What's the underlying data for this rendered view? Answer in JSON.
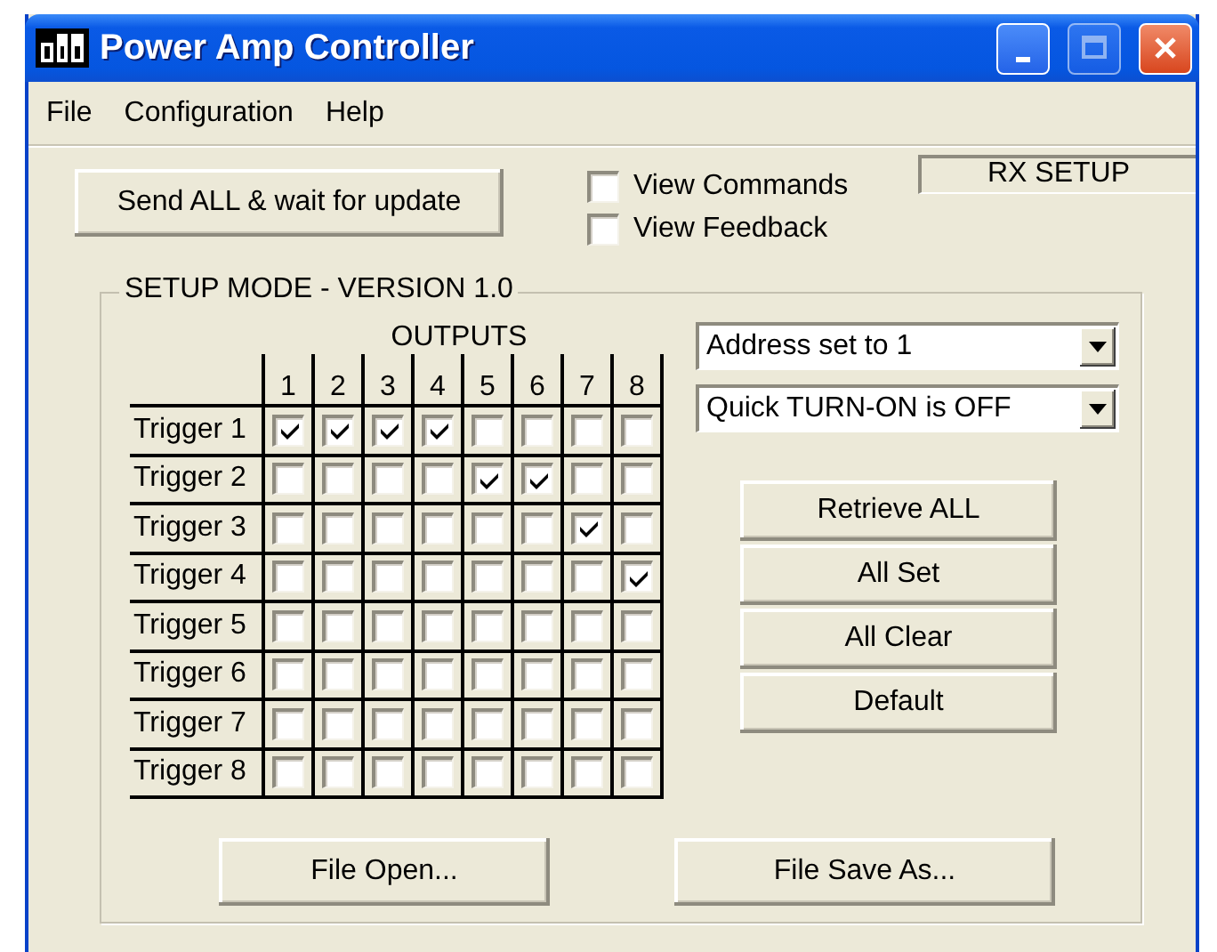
{
  "window": {
    "title": "Power Amp Controller"
  },
  "menu": [
    "File",
    "Configuration",
    "Help"
  ],
  "send_button": "Send ALL & wait for update",
  "view_options": [
    {
      "label": "View Commands",
      "checked": false
    },
    {
      "label": "View Feedback",
      "checked": false
    }
  ],
  "status_box": "RX SETUP",
  "setup_group": {
    "title": "SETUP MODE - VERSION 1.0",
    "outputs_heading": "OUTPUTS",
    "columns": [
      "1",
      "2",
      "3",
      "4",
      "5",
      "6",
      "7",
      "8"
    ],
    "triggers": [
      {
        "label": "Trigger 1",
        "outputs": [
          true,
          true,
          true,
          true,
          false,
          false,
          false,
          false
        ]
      },
      {
        "label": "Trigger 2",
        "outputs": [
          false,
          false,
          false,
          false,
          true,
          true,
          false,
          false
        ]
      },
      {
        "label": "Trigger 3",
        "outputs": [
          false,
          false,
          false,
          false,
          false,
          false,
          true,
          false
        ]
      },
      {
        "label": "Trigger 4",
        "outputs": [
          false,
          false,
          false,
          false,
          false,
          false,
          false,
          true
        ]
      },
      {
        "label": "Trigger 5",
        "outputs": [
          false,
          false,
          false,
          false,
          false,
          false,
          false,
          false
        ]
      },
      {
        "label": "Trigger 6",
        "outputs": [
          false,
          false,
          false,
          false,
          false,
          false,
          false,
          false
        ]
      },
      {
        "label": "Trigger 7",
        "outputs": [
          false,
          false,
          false,
          false,
          false,
          false,
          false,
          false
        ]
      },
      {
        "label": "Trigger 8",
        "outputs": [
          false,
          false,
          false,
          false,
          false,
          false,
          false,
          false
        ]
      }
    ]
  },
  "dropdowns": [
    {
      "value": "Address set to 1"
    },
    {
      "value": "Quick TURN-ON is OFF"
    }
  ],
  "action_buttons": [
    "Retrieve ALL",
    "All Set",
    "All Clear",
    "Default"
  ],
  "file_buttons": [
    "File Open...",
    "File Save As..."
  ]
}
